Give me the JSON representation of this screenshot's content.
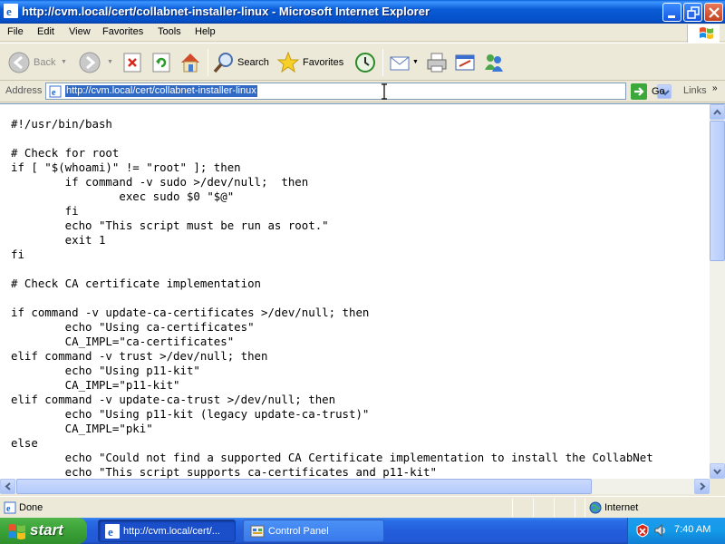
{
  "window": {
    "title": "http://cvm.local/cert/collabnet-installer-linux - Microsoft Internet Explorer"
  },
  "menu": [
    "File",
    "Edit",
    "View",
    "Favorites",
    "Tools",
    "Help"
  ],
  "toolbar": {
    "back_label": "Back",
    "search_label": "Search",
    "favorites_label": "Favorites"
  },
  "address": {
    "label": "Address",
    "url": "http://cvm.local/cert/collabnet-installer-linux",
    "go_label": "Go",
    "links_label": "Links"
  },
  "content": {
    "lines": [
      "#!/usr/bin/bash",
      "",
      "# Check for root",
      "if [ \"$(whoami)\" != \"root\" ]; then",
      "        if command -v sudo >/dev/null;  then",
      "                exec sudo $0 \"$@\"",
      "        fi",
      "        echo \"This script must be run as root.\"",
      "        exit 1",
      "fi",
      "",
      "# Check CA certificate implementation",
      "",
      "if command -v update-ca-certificates >/dev/null; then",
      "        echo \"Using ca-certificates\"",
      "        CA_IMPL=\"ca-certificates\"",
      "elif command -v trust >/dev/null; then",
      "        echo \"Using p11-kit\"",
      "        CA_IMPL=\"p11-kit\"",
      "elif command -v update-ca-trust >/dev/null; then",
      "        echo \"Using p11-kit (legacy update-ca-trust)\"",
      "        CA_IMPL=\"pki\"",
      "else",
      "        echo \"Could not find a supported CA Certificate implementation to install the CollabNet",
      "        echo \"This script supports ca-certificates and p11-kit\""
    ]
  },
  "status": {
    "text": "Done",
    "zone": "Internet"
  },
  "taskbar": {
    "start_label": "start",
    "tasks": [
      "http://cvm.local/cert/...",
      "Control Panel"
    ],
    "clock": "7:40 AM"
  }
}
